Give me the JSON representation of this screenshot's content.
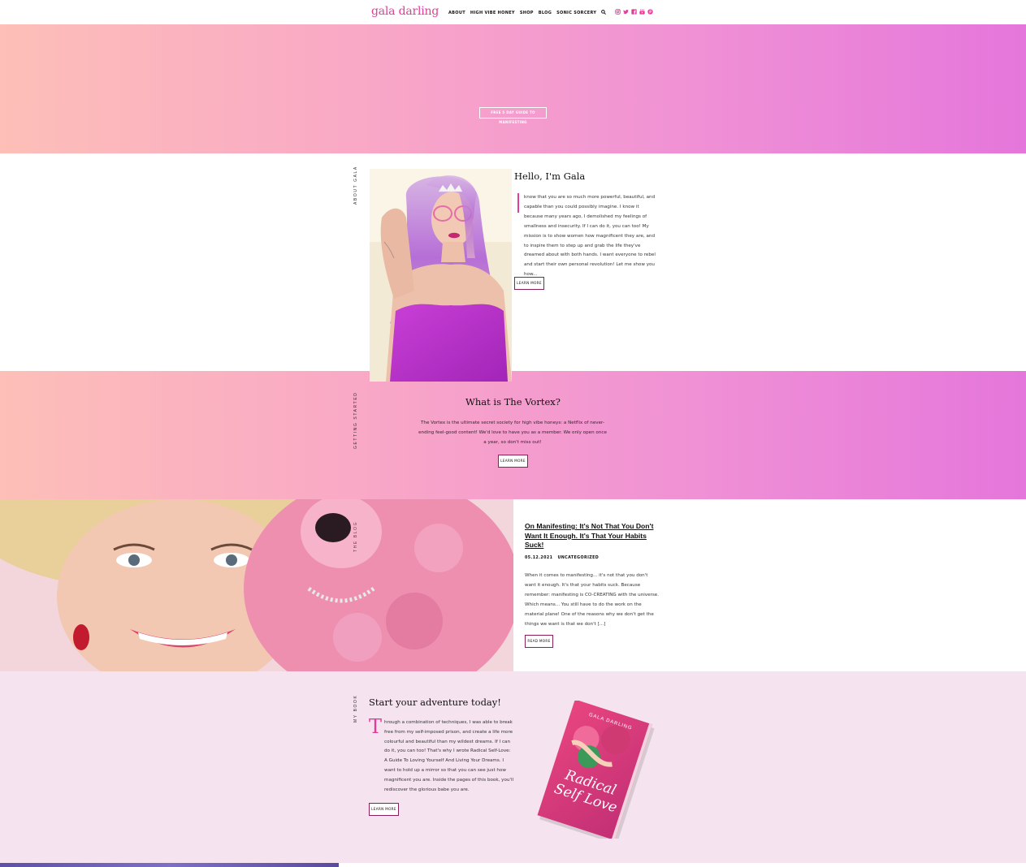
{
  "header": {
    "logo": "gala darling",
    "nav": [
      "About",
      "High Vibe Honey",
      "Shop",
      "Blog",
      "Sonic Sorcery"
    ],
    "socials": [
      "instagram-icon",
      "twitter-icon",
      "facebook-icon",
      "youtube-icon",
      "pinterest-icon"
    ]
  },
  "hero": {
    "button": "Free 5 day guide to manifesting"
  },
  "about": {
    "side_label": "About Gala",
    "title": "Hello, I'm Gala",
    "dropcap": "I",
    "body": "know that you are so much more powerful, beautiful, and capable than you could possibly imagine. I know it because many years ago, I demolished my feelings of smallness and insecurity. If I can do it, you can too! My mission is to show women how magnificent they are, and to inspire them to step up and grab the life they've dreamed about with both hands. I want everyone to rebel and start their own personal revolution! Let me show you how...",
    "button": "Learn More"
  },
  "vortex": {
    "side_label": "Getting Started",
    "title": "What is The Vortex?",
    "body": "The Vortex is the ultimate secret society for high vibe honeys: a Netflix of never-ending feel-good content! We'd love to have you as a member. We only open once a year, so don't miss out!",
    "button": "Learn More"
  },
  "blog": {
    "side_label": "The Blog",
    "title": "On Manifesting: It's Not That You Don't Want It Enough. It's That Your Habits Suck!",
    "date": "05.12.2021",
    "category": "Uncategorized",
    "body": "When it comes to manifesting... it's not that you don't want it enough. It's that your habits suck. Because remember: manifesting is CO-CREATING with the universe. Which means... You still have to do the work on the material plane! One of the reasons why we don't get the things we want is that we don't [...]",
    "button": "Read More"
  },
  "book": {
    "side_label": "My Book",
    "title": "Start your adventure today!",
    "dropcap": "T",
    "body": "hrough a combination of techniques, I was able to break free from my self-imposed prison, and create a life more colourful and beautiful than my wildest dreams. If I can do it, you can too! That's why I wrote Radical Self-Love: A Guide To Loving Yourself And Living Your Dreams. I want to hold up a mirror so that you can see just how magnificent you are. Inside the pages of this book, you'll rediscover the glorious babe you are.",
    "button": "Learn More",
    "cover_author": "GALA DARLING",
    "cover_title_1": "Radical",
    "cover_title_2": "Self Love"
  },
  "colors": {
    "accent": "#e13c97",
    "gradient_start": "#fdbfb8",
    "gradient_end": "#e576db",
    "book_bg": "#f5e3ef"
  }
}
